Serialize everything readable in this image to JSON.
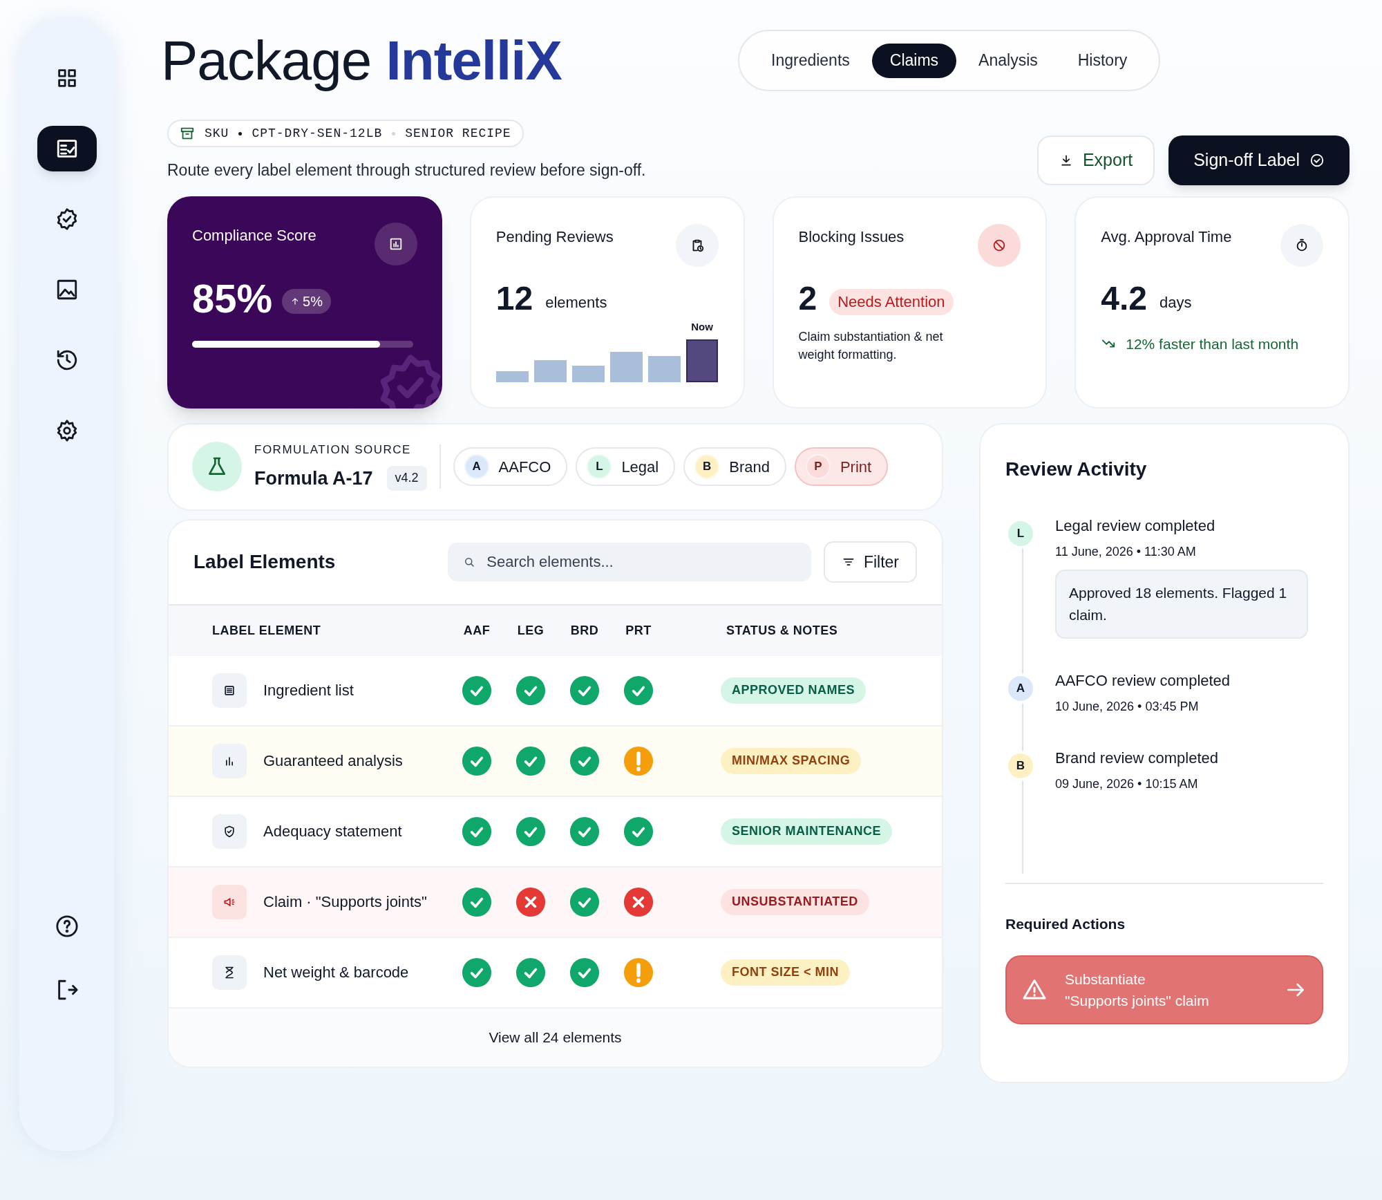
{
  "sidebar": {
    "items": [
      {
        "kind": "dashboard",
        "selected": false
      },
      {
        "kind": "review",
        "selected": true
      },
      {
        "kind": "badge",
        "selected": false
      },
      {
        "kind": "image",
        "selected": false
      },
      {
        "kind": "history",
        "selected": false
      },
      {
        "kind": "settings",
        "selected": false
      }
    ],
    "footer_items": [
      {
        "kind": "help"
      },
      {
        "kind": "logout"
      }
    ]
  },
  "brand": {
    "prefix": "Package",
    "name": "IntelliX"
  },
  "tabs": [
    {
      "label": "Ingredients",
      "selected": false
    },
    {
      "label": "Claims",
      "selected": true
    },
    {
      "label": "Analysis",
      "selected": false
    },
    {
      "label": "History",
      "selected": false
    }
  ],
  "sku": {
    "label": "SKU",
    "code": "CPT-DRY-SEN-12LB",
    "recipe": "SENIOR RECIPE"
  },
  "subtitle": "Route every label element through structured review before sign-off.",
  "actions": [
    {
      "label": "Export",
      "kind": "secondary"
    },
    {
      "label": "Sign-off Label",
      "kind": "primary"
    }
  ],
  "stats": [
    {
      "kind": "score",
      "title": "Compliance Score",
      "value": "85%",
      "delta": "5%",
      "level": 0.85
    },
    {
      "kind": "pending",
      "title": "Pending Reviews",
      "value": "12",
      "unit": "elements",
      "chart_label": "Now"
    },
    {
      "kind": "blocking",
      "title": "Blocking Issues",
      "value": "2",
      "tag": "Needs Attention",
      "note": "Claim substantiation & net weight formatting."
    },
    {
      "kind": "time",
      "title": "Avg. Approval Time",
      "value": "4.2",
      "unit": "days",
      "trend": "12% faster than last month"
    }
  ],
  "formulation": {
    "caption": "FORMULATION SOURCE",
    "name": "Formula A-17",
    "version": "v4.2",
    "reviewers": [
      {
        "initial": "A",
        "label": "AAFCO",
        "color": "#dbe7fb",
        "flagged": false
      },
      {
        "initial": "L",
        "label": "Legal",
        "color": "#d5f5e6",
        "flagged": false
      },
      {
        "initial": "B",
        "label": "Brand",
        "color": "#fdf1c4",
        "flagged": false
      },
      {
        "initial": "P",
        "label": "Print",
        "color": "#fbdcdc",
        "flagged": true
      }
    ]
  },
  "table": {
    "title": "Label Elements",
    "search": {
      "placeholder": "Search elements..."
    },
    "filter": "Filter",
    "columns": [
      "LABEL ELEMENT",
      "AAF",
      "LEG",
      "BRD",
      "PRT",
      "STATUS & NOTES"
    ],
    "rows": [
      {
        "kind": "neutral",
        "label": "Ingredient list",
        "checks": [
          {
            "kind": "pass"
          },
          {
            "kind": "pass"
          },
          {
            "kind": "pass"
          },
          {
            "kind": "pass"
          }
        ],
        "status": {
          "label": "APPROVED NAMES",
          "kind": "ok"
        }
      },
      {
        "kind": "warning",
        "label": "Guaranteed analysis",
        "checks": [
          {
            "kind": "pass"
          },
          {
            "kind": "pass"
          },
          {
            "kind": "pass"
          },
          {
            "kind": "warn"
          }
        ],
        "status": {
          "label": "MIN/MAX SPACING",
          "kind": "warn"
        }
      },
      {
        "kind": "neutral",
        "label": "Adequacy statement",
        "checks": [
          {
            "kind": "pass"
          },
          {
            "kind": "pass"
          },
          {
            "kind": "pass"
          },
          {
            "kind": "pass"
          }
        ],
        "status": {
          "label": "SENIOR MAINTENANCE",
          "kind": "ok"
        }
      },
      {
        "kind": "blocking",
        "label": "Claim · \"Supports joints\"",
        "checks": [
          {
            "kind": "pass"
          },
          {
            "kind": "fail"
          },
          {
            "kind": "pass"
          },
          {
            "kind": "fail"
          }
        ],
        "status": {
          "label": "UNSUBSTANTIATED",
          "kind": "fail"
        }
      },
      {
        "kind": "neutral",
        "label": "Net weight & barcode",
        "checks": [
          {
            "kind": "pass"
          },
          {
            "kind": "pass"
          },
          {
            "kind": "pass"
          },
          {
            "kind": "warn"
          }
        ],
        "status": {
          "label": "FONT SIZE < MIN",
          "kind": "warn"
        }
      }
    ],
    "footer": "View all 24 elements"
  },
  "activity": {
    "title": "Review Activity",
    "items": [
      {
        "initial": "L",
        "color": "#d5f5e6",
        "title": "Legal review completed",
        "time": "11 June, 2026 • 11:30 AM",
        "note": "Approved 18 elements. Flagged 1 claim."
      },
      {
        "initial": "A",
        "color": "#dbe7fb",
        "title": "AAFCO review completed",
        "time": "10 June, 2026 • 03:45 PM"
      },
      {
        "initial": "B",
        "color": "#fdf1c4",
        "title": "Brand review completed",
        "time": "09 June, 2026 • 10:15 AM"
      }
    ],
    "required_title": "Required Actions",
    "required": [
      {
        "line1": "Substantiate",
        "line2": "\"Supports joints\" claim"
      }
    ]
  }
}
